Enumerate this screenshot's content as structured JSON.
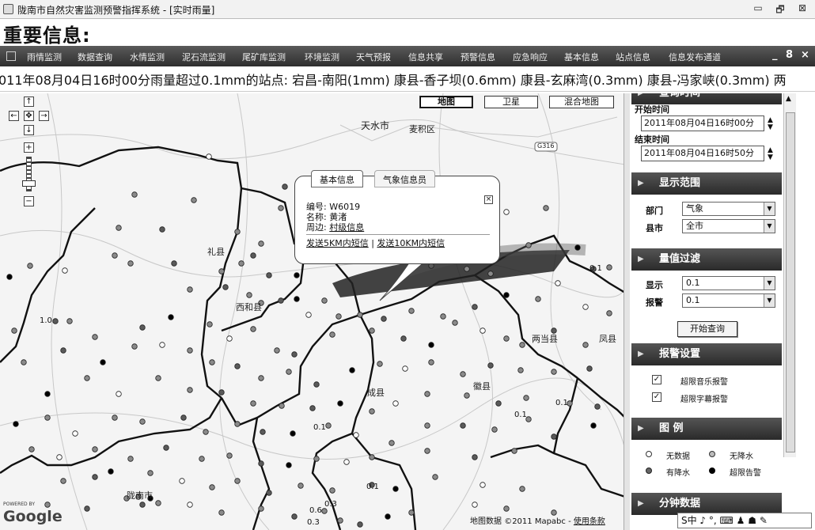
{
  "window": {
    "title": "陇南市自然灾害监测预警指挥系统 - [实时雨量]",
    "min": "▭",
    "restore": "🗗",
    "close": "⊠"
  },
  "app": {
    "title": "重要信息:"
  },
  "menu": {
    "items": [
      "雨情监测",
      "数据查询",
      "水情监测",
      "泥石流监测",
      "尾矿库监测",
      "环境监测",
      "天气预报",
      "信息共享",
      "预警信息",
      "应急响应",
      "基本信息",
      "站点信息",
      "信息发布通道"
    ],
    "minimize": "_",
    "restore": "8",
    "close": "×"
  },
  "ticker": {
    "text": "011年08月04日16时00分雨量超过0.1mm的站点: 宕昌-南阳(1mm) 康县-香子坝(0.6mm) 康县-玄麻湾(0.3mm) 康县-冯家峡(0.3mm) 两"
  },
  "map": {
    "types": [
      "地图",
      "卫星",
      "混合地图"
    ],
    "active_type": "地图",
    "nav": {
      "up": "↑",
      "down": "↓",
      "left": "←",
      "right": "→",
      "center": "✥",
      "zoom_in": "+",
      "zoom_out": "−"
    },
    "cities": [
      "天水市",
      "麦积区",
      "礼县",
      "西和县",
      "成县",
      "徽县",
      "两当县",
      "凤县",
      "陇南市"
    ],
    "road_badge": "G316",
    "value_labels": [
      "1.0",
      "0.1",
      "0.1",
      "0.1",
      "0.1",
      "0.1",
      "0.6",
      "0.3",
      "0.3"
    ],
    "popup": {
      "tabs": [
        "基本信息",
        "气象信息员"
      ],
      "code_label": "编号:",
      "code": "W6019",
      "name_label": "名称:",
      "name": "黄渚",
      "around_label": "周边:",
      "around": "村级信息",
      "sms5": "发送5KM内短信",
      "sep": "|",
      "sms10": "发送10KM内短信",
      "close": "×"
    },
    "powered_by": "POWERED BY",
    "google": "Google",
    "copyright_prefix": "地图数据",
    "copyright": "©2011 Mapabc -",
    "terms": "使用条款"
  },
  "side": {
    "time_panel": {
      "title": "查询时间",
      "start_label": "开始时间",
      "start": "2011年08月04日16时00分",
      "end_label": "结束时间",
      "end": "2011年08月04日16时50分"
    },
    "range_panel": {
      "title": "显示范围",
      "dept_label": "部门",
      "dept": "气象",
      "county_label": "县市",
      "county": "全市"
    },
    "filter_panel": {
      "title": "量值过滤",
      "show_label": "显示",
      "show": "0.1",
      "alarm_label": "报警",
      "alarm": "0.1",
      "query_button": "开始查询"
    },
    "alarm_panel": {
      "title": "报警设置",
      "music": "超限音乐报警",
      "subtitle": "超限字幕报警"
    },
    "legend_panel": {
      "title": "图 例",
      "items": [
        "无数据",
        "无降水",
        "有降水",
        "超限告警"
      ]
    },
    "minute_panel": {
      "title": "分钟数据"
    }
  },
  "ime": {
    "text": "S中 ♪ °, ⌨ ♟ ☗ ✎"
  },
  "colors": {
    "menubar": "#3a3a3a",
    "panel_header": "#333333",
    "station_fill": "#777777"
  }
}
